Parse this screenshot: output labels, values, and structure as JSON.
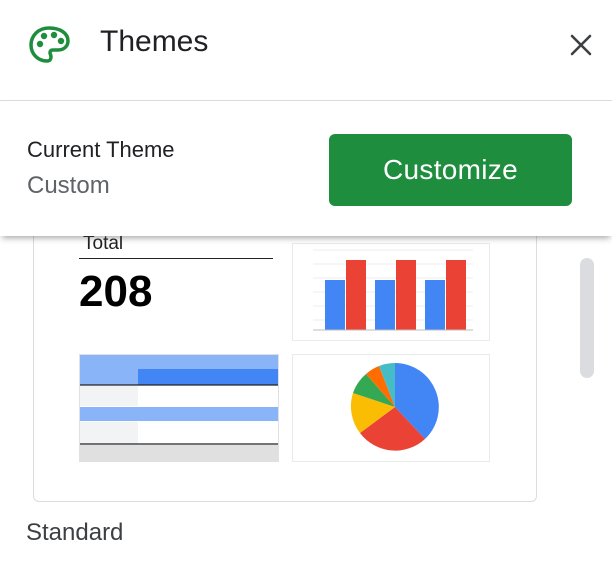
{
  "header": {
    "title": "Themes",
    "icon": "palette-icon",
    "close_icon": "close-icon",
    "accent": "#1e8e3e"
  },
  "current_theme": {
    "label": "Current Theme",
    "value": "Custom",
    "customize_label": "Customize",
    "button_color": "#1e8e3e"
  },
  "preview": {
    "total_label": "Total",
    "total_value": "208",
    "bar_colors": [
      "#4285f4",
      "#ea4335"
    ],
    "pie_colors": [
      "#4285f4",
      "#ea4335",
      "#fbbc04",
      "#34a853",
      "#ff6d01",
      "#46bdc6"
    ],
    "table_colors": [
      "#4285f4",
      "#8ab4f8",
      "#e8eaed"
    ]
  },
  "sections": {
    "standard_label": "Standard"
  }
}
